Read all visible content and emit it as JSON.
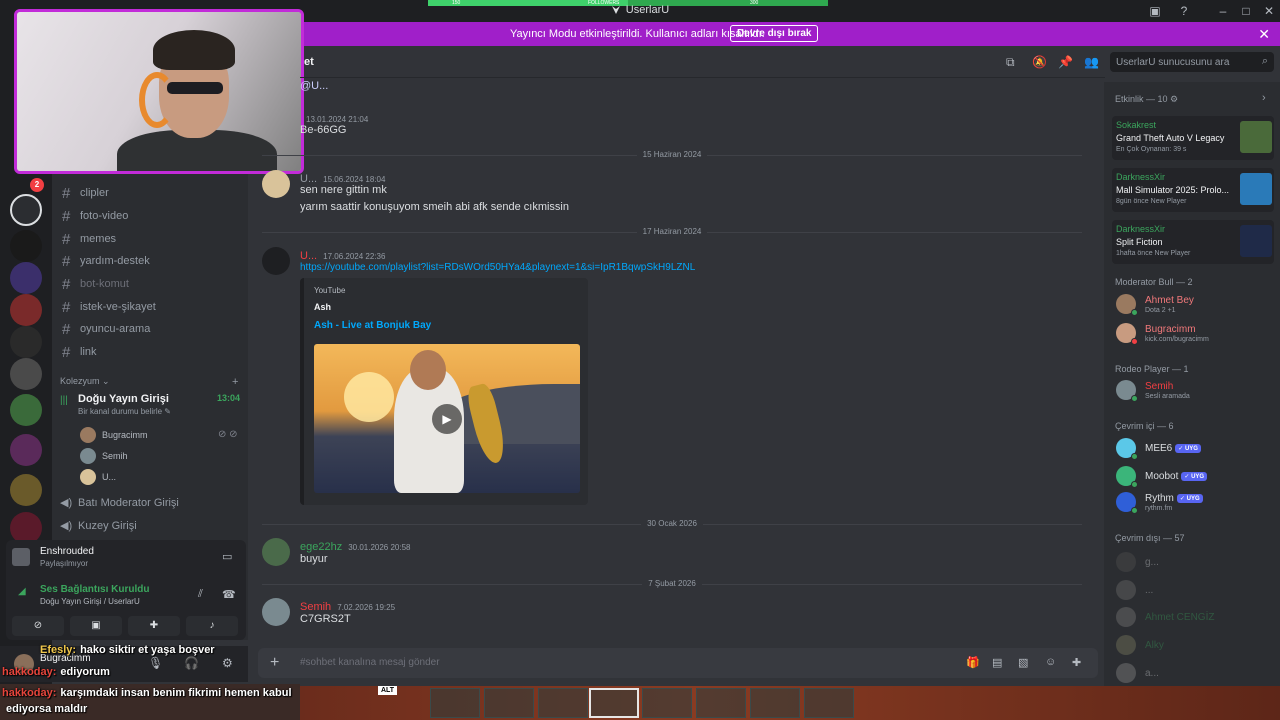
{
  "window": {
    "title": "UserlarU",
    "followers_label": "FOLLOWERS",
    "followers_left": "150",
    "followers_right": "300",
    "followers_progress": 0.5
  },
  "banner": {
    "message": "Yayıncı Modu etkinleştirildi. Kullanıcı adları kısaltıldı.",
    "button": "Devre dışı bırak"
  },
  "servers": {
    "badge": "2"
  },
  "channels": [
    {
      "name": "clipler"
    },
    {
      "name": "foto-video"
    },
    {
      "name": "memes"
    },
    {
      "name": "yardım-destek"
    },
    {
      "name": "bot-komut"
    },
    {
      "name": "istek-ve-şikayet"
    },
    {
      "name": "oyuncu-arama"
    },
    {
      "name": "link"
    }
  ],
  "category": {
    "name": "Kolezyum",
    "voice_channel": "Doğu Yayın Girişi",
    "voice_time": "13:04",
    "voice_status": "Bir kanal durumu belirle",
    "voice_users": [
      "Bugracimm",
      "Semih",
      "U..."
    ],
    "other_voice": [
      "Batı Moderator Girişi",
      "Kuzey Girişi"
    ]
  },
  "panel": {
    "activity_name": "Enshrouded",
    "activity_sub": "Paylaşılmıyor",
    "connection_status": "Ses Bağlantısı Kuruldu",
    "connection_sub": "Doğu Yayın Girişi / UserlarU",
    "username": "Bugracimm"
  },
  "chat": {
    "header": "et",
    "messages": [
      {
        "author": "",
        "time": "13.01.2024 21:04",
        "lines": [
          "@U...",
          "Be-66GG"
        ]
      },
      {
        "author": "U...",
        "time": "15.06.2024 18:04",
        "lines": [
          "sen nere gittin mk",
          "yarım saattir konuşuyom smeih abi afk sende cıkmissin"
        ]
      },
      {
        "author": "U...",
        "time": "17.06.2024 22:36",
        "link": "https://youtube.com/playlist?list=RDsWOrd50HYa4&playnext=1&si=IpR1BqwpSkH9LZNL"
      },
      {
        "author": "ege22hz",
        "time": "30.01.2026 20:58",
        "lines": [
          "buyur"
        ]
      },
      {
        "author": "Semih",
        "time": "7.02.2026 19:25",
        "lines": [
          "C7GRS2T"
        ]
      }
    ],
    "dividers": [
      "15 Haziran 2024",
      "17 Haziran 2024",
      "30 Ocak 2026",
      "7 Şubat 2026"
    ],
    "embed": {
      "provider": "YouTube",
      "author": "Ash",
      "title": "Ash - Live at Bonjuk Bay"
    },
    "placeholder": "#sohbet kanalına mesaj gönder"
  },
  "search": {
    "placeholder": "UserlarU sunucusunu ara"
  },
  "members": {
    "activity_header": "Etkinlik — 10",
    "activities": [
      {
        "user": "Sokakrest",
        "game": "Grand Theft Auto V Legacy",
        "sub": "En Çok Oynanan: 39 s"
      },
      {
        "user": "DarknessXir",
        "game": "Mall Simulator 2025: Prolo...",
        "sub": "8gün önce  New Player"
      },
      {
        "user": "DarknessXir",
        "game": "Split Fiction",
        "sub": "1hafta önce  New Player"
      }
    ],
    "groups": [
      {
        "header": "Moderator Bull — 2",
        "items": [
          {
            "name": "Ahmet Bey",
            "status": "Dota 2 +1"
          },
          {
            "name": "Bugracimm",
            "status": "kick.com/bugracimm"
          }
        ]
      },
      {
        "header": "Rodeo Player — 1",
        "items": [
          {
            "name": "Semih",
            "status": "Sesli aramada"
          }
        ]
      },
      {
        "header": "Çevrim içi — 6",
        "items": [
          {
            "name": "MEE6",
            "status": "",
            "bot": "UYG"
          },
          {
            "name": "Moobot",
            "status": "",
            "bot": "UYG"
          },
          {
            "name": "Rythm",
            "status": "rythm.fm",
            "bot": "UYG"
          }
        ]
      },
      {
        "header": "Çevrim dışı — 57",
        "items": [
          {
            "name": "g..."
          },
          {
            "name": "..."
          },
          {
            "name": "Ahmet CENGİZ"
          },
          {
            "name": "Alky"
          },
          {
            "name": "a..."
          }
        ]
      }
    ]
  },
  "stream_chat": [
    {
      "user": "Efesly:",
      "text": "hako siktir et yaşa boşver"
    },
    {
      "user": "hakkoday:",
      "text": "ediyorum"
    },
    {
      "user": "hakkoday:",
      "text": "karşımdaki insan benim fikrimi hemen kabul"
    },
    {
      "user": "",
      "text": "ediyorsa maldır"
    }
  ],
  "hotbar": {
    "alt_key": "ALT"
  },
  "colors": {
    "banner": "#a01fc9",
    "online": "#3ba55d",
    "link": "#00a8fc",
    "mod_name": "#f0787a",
    "semih": "#f23f43"
  }
}
